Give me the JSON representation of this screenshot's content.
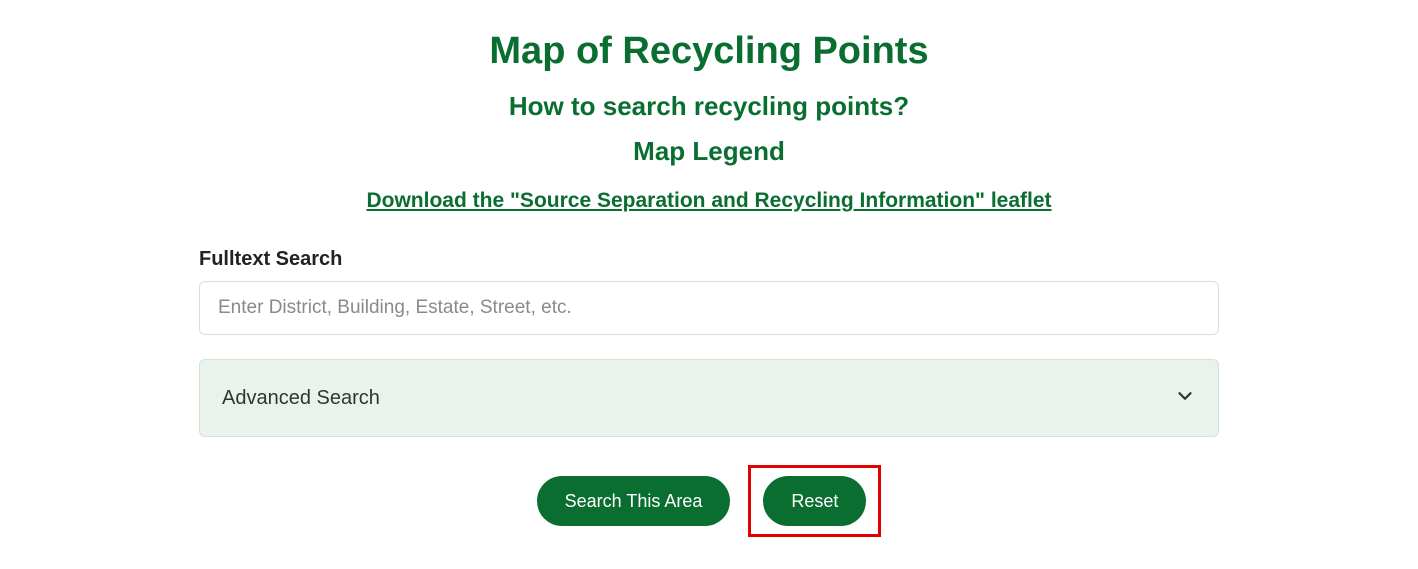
{
  "header": {
    "title": "Map of Recycling Points",
    "howToLink": "How to search recycling points?",
    "legendLink": "Map Legend",
    "downloadLink": "Download the \"Source Separation and Recycling Information\" leaflet"
  },
  "search": {
    "label": "Fulltext Search",
    "placeholder": "Enter District, Building, Estate, Street, etc.",
    "value": ""
  },
  "advanced": {
    "label": "Advanced Search"
  },
  "buttons": {
    "searchArea": "Search This Area",
    "reset": "Reset"
  }
}
